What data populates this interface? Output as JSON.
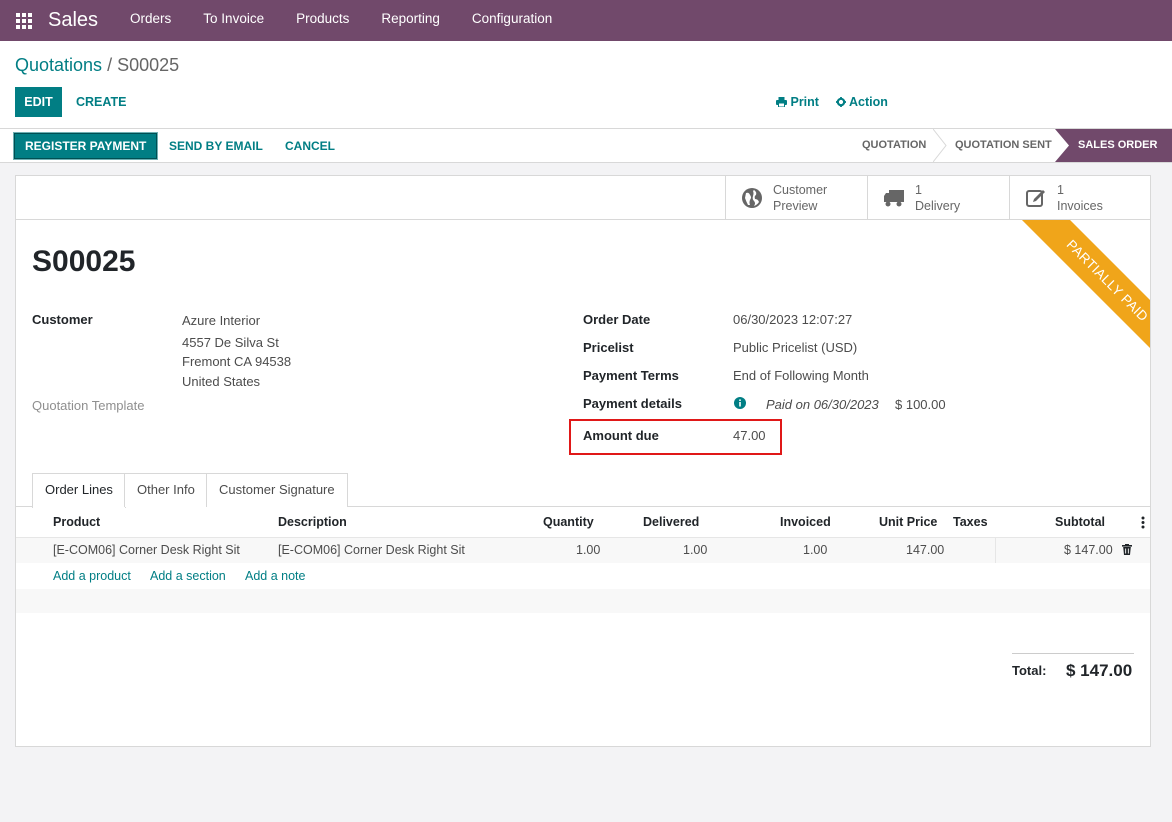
{
  "navbar": {
    "app_name": "Sales",
    "menu": [
      "Orders",
      "To Invoice",
      "Products",
      "Reporting",
      "Configuration"
    ],
    "background": "#71496b"
  },
  "breadcrumb": {
    "parent": "Quotations",
    "separator": " / ",
    "current": "S00025"
  },
  "buttons": {
    "edit": "EDIT",
    "create": "CREATE",
    "print": "Print",
    "action": "Action"
  },
  "statusbar": {
    "register_payment": "REGISTER PAYMENT",
    "send_by_email": "SEND BY EMAIL",
    "cancel": "CANCEL",
    "stages": [
      "QUOTATION",
      "QUOTATION SENT",
      "SALES ORDER"
    ],
    "active_stage": "SALES ORDER"
  },
  "smart_buttons": {
    "preview": {
      "line1": "Customer",
      "line2": "Preview",
      "icon": "globe-icon"
    },
    "delivery": {
      "line1": "1",
      "line2": "Delivery",
      "icon": "truck-icon"
    },
    "invoices": {
      "line1": "1",
      "line2": "Invoices",
      "icon": "edit-icon"
    }
  },
  "ribbon": "PARTIALLY PAID",
  "order": {
    "name": "S00025",
    "customer_label": "Customer",
    "customer_name": "Azure Interior",
    "address_line1": "4557 De Silva St",
    "address_line2": "Fremont CA 94538",
    "address_line3": "United States",
    "template_label": "Quotation Template",
    "order_date_label": "Order Date",
    "order_date": "06/30/2023 12:07:27",
    "pricelist_label": "Pricelist",
    "pricelist": "Public Pricelist (USD)",
    "payment_terms_label": "Payment Terms",
    "payment_terms": "End of Following Month",
    "payment_details_label": "Payment details",
    "payment_details_note": "Paid on 06/30/2023",
    "payment_details_amount": "$ 100.00",
    "amount_due_label": "Amount due",
    "amount_due": "47.00"
  },
  "tabs": [
    "Order Lines",
    "Other Info",
    "Customer Signature"
  ],
  "table": {
    "headers": [
      "Product",
      "Description",
      "Quantity",
      "Delivered",
      "Invoiced",
      "Unit Price",
      "Taxes",
      "Subtotal"
    ],
    "rows": [
      {
        "product": "[E-COM06] Corner Desk Right Sit",
        "description": "[E-COM06] Corner Desk Right Sit",
        "quantity": "1.00",
        "delivered": "1.00",
        "invoiced": "1.00",
        "unit_price": "147.00",
        "taxes": "",
        "subtotal": "$ 147.00"
      }
    ],
    "add_product": "Add a product",
    "add_section": "Add a section",
    "add_note": "Add a note"
  },
  "totals": {
    "label": "Total:",
    "value": "$ 147.00"
  },
  "colors": {
    "primary": "#017e84",
    "ribbon": "#f0a51a",
    "highlight_box": "#e01818"
  }
}
